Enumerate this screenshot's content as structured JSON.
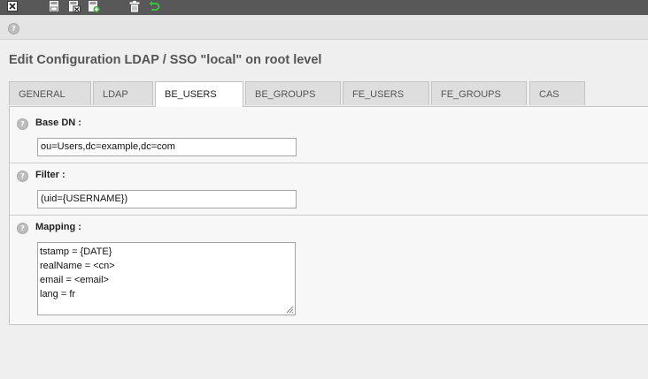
{
  "toolbar": {
    "buttons": [
      {
        "icon": "close-icon"
      },
      {
        "icon": "save-icon"
      },
      {
        "icon": "save-close-icon"
      },
      {
        "icon": "save-new-icon"
      },
      {
        "icon": "delete-icon"
      },
      {
        "icon": "undo-icon"
      }
    ]
  },
  "page": {
    "title": "Edit Configuration LDAP / SSO \"local\" on root level"
  },
  "tabs": [
    {
      "label": "GENERAL"
    },
    {
      "label": "LDAP"
    },
    {
      "label": "BE_USERS",
      "active": true
    },
    {
      "label": "BE_GROUPS"
    },
    {
      "label": "FE_USERS"
    },
    {
      "label": "FE_GROUPS"
    },
    {
      "label": "CAS"
    }
  ],
  "fields": {
    "base_dn": {
      "label": "Base DN :",
      "value": "ou=Users,dc=example,dc=com"
    },
    "filter": {
      "label": "Filter :",
      "value": "(uid={USERNAME})"
    },
    "mapping": {
      "label": "Mapping :",
      "lines": [
        "tstamp = {DATE}",
        "realName = <cn>",
        "email = <email>",
        "lang = fr"
      ]
    }
  },
  "colors": {
    "toolbar_bg": "#585858",
    "undo_green": "#3fbf3f",
    "panel_bg": "#f7f7f7"
  }
}
